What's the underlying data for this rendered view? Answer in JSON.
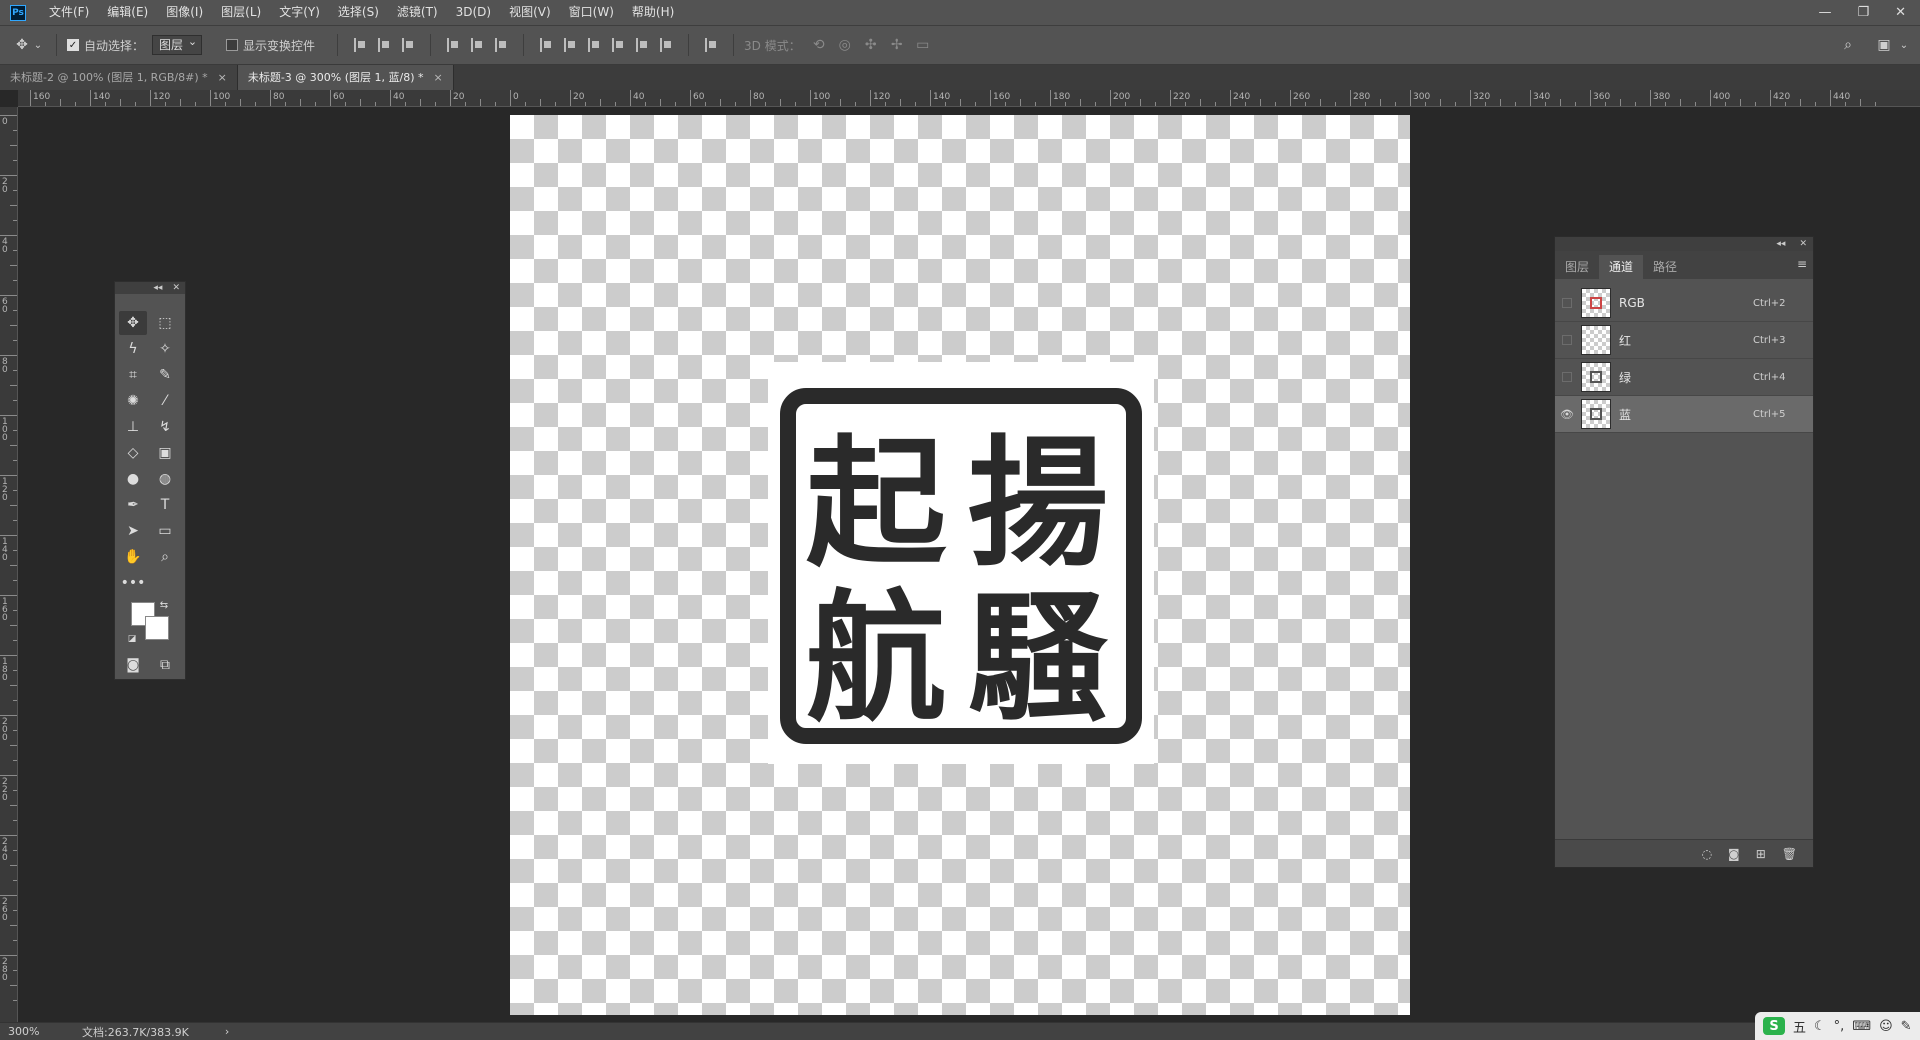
{
  "app": {
    "logo": "Ps"
  },
  "menu": [
    "文件(F)",
    "编辑(E)",
    "图像(I)",
    "图层(L)",
    "文字(Y)",
    "选择(S)",
    "滤镜(T)",
    "3D(D)",
    "视图(V)",
    "窗口(W)",
    "帮助(H)"
  ],
  "window_controls": {
    "minimize": "—",
    "restore": "❐",
    "close": "✕"
  },
  "options": {
    "auto_select_label": "自动选择：",
    "auto_select_checked": true,
    "auto_select_target": "图层",
    "show_transform_label": "显示变换控件",
    "mode_3d_label": "3D 模式："
  },
  "tabs": [
    {
      "title": "未标题-2 @ 100% (图层 1, RGB/8#) *",
      "active": false
    },
    {
      "title": "未标题-3 @ 300% (图层 1, 蓝/8) *",
      "active": true
    }
  ],
  "ruler_h_labels": [
    "160",
    "140",
    "120",
    "100",
    "80",
    "60",
    "40",
    "20",
    "0",
    "20",
    "40",
    "60",
    "80",
    "100",
    "120",
    "140",
    "160",
    "180",
    "200",
    "220",
    "240",
    "260",
    "280",
    "300",
    "320",
    "340",
    "360",
    "380",
    "400",
    "420",
    "440"
  ],
  "ruler_v_labels": [
    "0",
    "20",
    "40",
    "60",
    "80",
    "100",
    "120",
    "140",
    "160",
    "180",
    "200",
    "220",
    "240",
    "260",
    "280"
  ],
  "seal": {
    "characters": [
      "揚",
      "起",
      "騷",
      "航"
    ]
  },
  "tools_panel": {
    "collapse": "◂◂",
    "close": "✕",
    "foreground_color": "#ffffff",
    "background_color": "#ffffff"
  },
  "channels_panel": {
    "tabs": [
      "图层",
      "通道",
      "路径"
    ],
    "active_tab": "通道",
    "channels": [
      {
        "name": "RGB",
        "shortcut": "Ctrl+2",
        "visible": false,
        "selected": false
      },
      {
        "name": "红",
        "shortcut": "Ctrl+3",
        "visible": false,
        "selected": false
      },
      {
        "name": "绿",
        "shortcut": "Ctrl+4",
        "visible": false,
        "selected": false
      },
      {
        "name": "蓝",
        "shortcut": "Ctrl+5",
        "visible": true,
        "selected": true
      }
    ]
  },
  "status": {
    "zoom": "300%",
    "doc_info": "文档:263.7K/383.9K",
    "arrow": "›"
  },
  "tray": {
    "ime_logo": "S",
    "ime_mode": "五",
    "items": [
      "☾",
      "°,",
      "⌨",
      "☺",
      "✎"
    ]
  }
}
